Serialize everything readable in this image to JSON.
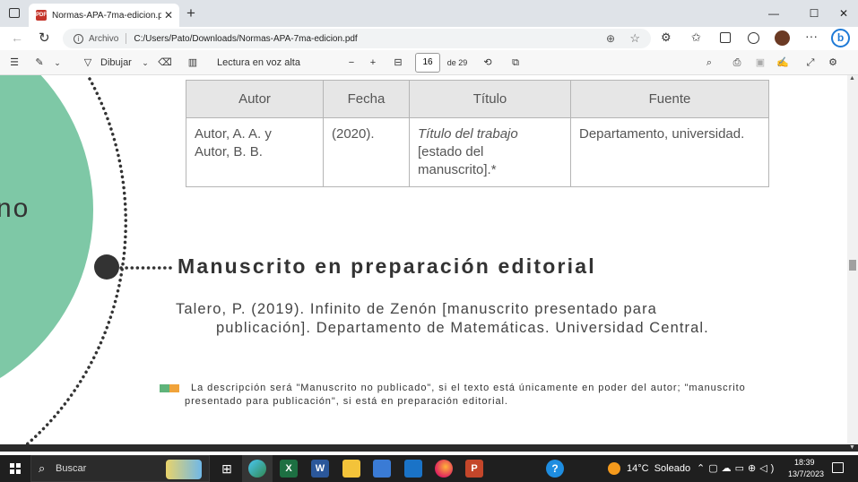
{
  "browser": {
    "tab_title": "Normas-APA-7ma-edicion.pdf",
    "address_prefix": "Archivo",
    "address_url": "C:/Users/Pato/Downloads/Normas-APA-7ma-edicion.pdf"
  },
  "pdf_toolbar": {
    "draw_label": "Dibujar",
    "read_aloud_label": "Lectura en voz alta",
    "page_current": "16",
    "page_total": "de 29"
  },
  "document": {
    "circle_text": "no",
    "table": {
      "headers": [
        "Autor",
        "Fecha",
        "Título",
        "Fuente"
      ],
      "row": {
        "autor_1": "Autor, A. A. y",
        "autor_2": "Autor, B. B.",
        "fecha": "(2020).",
        "titulo_italic": "Título del trabajo",
        "titulo_rest_1": "[estado del",
        "titulo_rest_2": "manuscrito].*",
        "fuente": "Departamento, universidad."
      }
    },
    "section_heading": "Manuscrito en preparación editorial",
    "reference_line1": "Talero, P. (2019). Infinito de Zenón [manuscrito presentado para",
    "reference_line2": "publicación]. Departamento de Matemáticas. Universidad Central.",
    "note_line1": "La descripción será \"Manuscrito no publicado\", si el texto está únicamente en poder del autor; \"manuscrito",
    "note_line2": "presentado para publicación\", si está en preparación editorial.",
    "colors": {
      "circle_fill": "#7ec8a6",
      "note_green": "#5fb37a",
      "note_orange": "#f0a33a"
    }
  },
  "taskbar": {
    "search_label": "Buscar",
    "weather": "14°C  Soleado",
    "time": "18:39",
    "date": "13/7/2023"
  }
}
